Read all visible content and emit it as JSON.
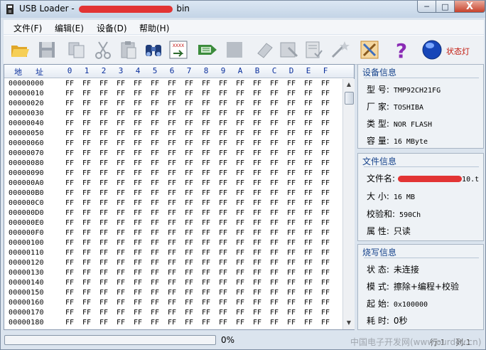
{
  "window": {
    "title_prefix": "USB Loader -",
    "title_suffix": "bin",
    "min_label": "─",
    "max_label": "□",
    "close_label": "X"
  },
  "menu": [
    "文件(F)",
    "编辑(E)",
    "设备(D)",
    "帮助(H)"
  ],
  "toolbar": {
    "status_light_label": "状态灯"
  },
  "hex": {
    "address_header": [
      "地",
      "址"
    ],
    "columns": [
      "0",
      "1",
      "2",
      "3",
      "4",
      "5",
      "6",
      "7",
      "8",
      "9",
      "A",
      "B",
      "C",
      "D",
      "E",
      "F"
    ],
    "fill_value": "FF",
    "addresses": [
      "00000000",
      "00000010",
      "00000020",
      "00000030",
      "00000040",
      "00000050",
      "00000060",
      "00000070",
      "00000080",
      "00000090",
      "000000A0",
      "000000B0",
      "000000C0",
      "000000D0",
      "000000E0",
      "000000F0",
      "00000100",
      "00000110",
      "00000120",
      "00000130",
      "00000140",
      "00000150",
      "00000160",
      "00000170",
      "00000180"
    ]
  },
  "device_info": {
    "title": "设备信息",
    "model_label": "型  号:",
    "model_value": "TMP92CH21FG",
    "vendor_label": "厂  家:",
    "vendor_value": "TOSHIBA",
    "type_label": "类  型:",
    "type_value": "NOR FLASH",
    "capacity_label": "容  量:",
    "capacity_value": "16 MByte"
  },
  "file_info": {
    "title": "文件信息",
    "name_label": "文件名:",
    "name_value_tail": "10.t",
    "size_label": "大  小:",
    "size_value": "16 MB",
    "checksum_label": "校验和:",
    "checksum_value": "590Ch",
    "attr_label": "属  性:",
    "attr_value": "只读"
  },
  "burn_info": {
    "title": "烧写信息",
    "status_label": "状  态:",
    "status_value": "未连接",
    "mode_label": "模  式:",
    "mode_value": "擦除+编程+校验",
    "start_label": "起  始:",
    "start_value": "0x100000",
    "time_label": "耗  时:",
    "time_value": "0秒"
  },
  "progress": {
    "percent_label": "0%",
    "fraction": 0.0
  },
  "statusbar": {
    "row_label": "行:1",
    "col_label": "列:1"
  },
  "watermark": "中国电子开发网(www.ourdev.cn)"
}
